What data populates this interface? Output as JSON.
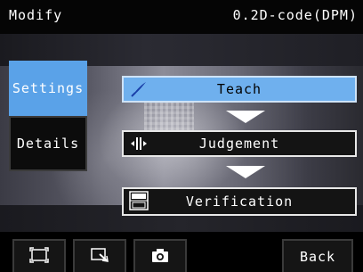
{
  "header": {
    "mode_label": "Modify",
    "item_label": "0.2D-code(DPM)"
  },
  "tabs": [
    {
      "label": "Settings",
      "active": true
    },
    {
      "label": "Details",
      "active": false
    }
  ],
  "flow": {
    "steps": [
      {
        "label": "Teach",
        "icon": "feather-pen-icon",
        "selected": true
      },
      {
        "label": "Judgement",
        "icon": "judgement-bars-icon",
        "selected": false
      },
      {
        "label": "Verification",
        "icon": "abc-verify-icon",
        "selected": false
      }
    ]
  },
  "toolbar": {
    "buttons": [
      {
        "icon": "full-view-frame-icon"
      },
      {
        "icon": "zoom-region-icon"
      },
      {
        "icon": "camera-icon"
      }
    ],
    "back_label": "Back"
  },
  "colors": {
    "accent_active": "#5aa2e8",
    "teach_fill": "#6fb0ee"
  }
}
